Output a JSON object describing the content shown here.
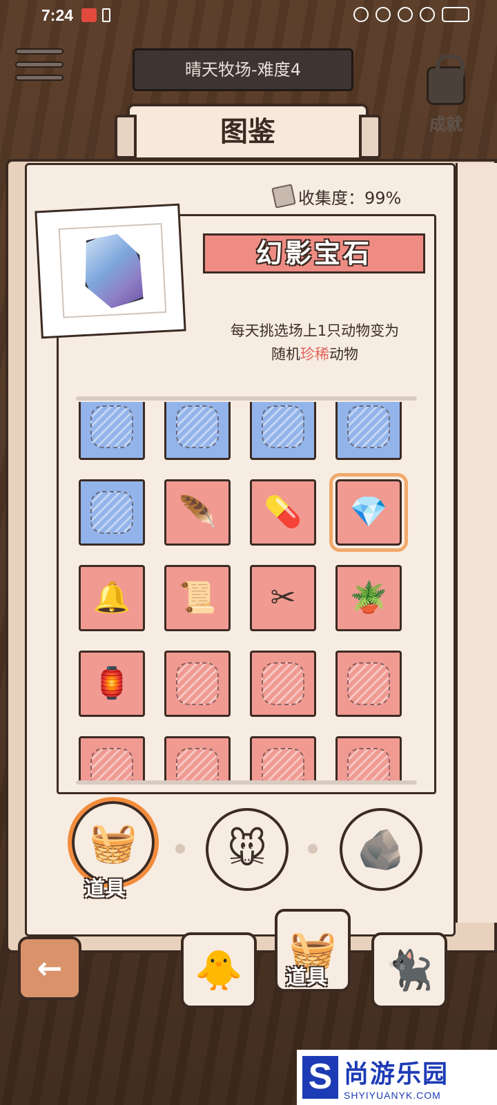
{
  "status_bar": {
    "time": "7:24"
  },
  "header": {
    "level_title": "晴天牧场-难度4",
    "achievements_label": "成就",
    "plaque_title": "图鉴"
  },
  "collection": {
    "label": "收集度：99%"
  },
  "detail": {
    "item_name": "幻影宝石",
    "desc_line1": "每天挑选场上1只动物变为",
    "desc_line2_prefix": "随机",
    "desc_line2_highlight": "珍稀",
    "desc_line2_suffix": "动物",
    "highlight_color": "#e0645c"
  },
  "grid_colors": {
    "pink": "#f09a92",
    "blue": "#93b4ea",
    "selected_outline": "#f2a96a"
  },
  "grid": [
    {
      "color": "blue",
      "icon": "locked-silhouette"
    },
    {
      "color": "blue",
      "icon": "locked-silhouette"
    },
    {
      "color": "blue",
      "icon": "locked-silhouette"
    },
    {
      "color": "blue",
      "icon": "locked-silhouette"
    },
    {
      "color": "blue",
      "icon": "locked-silhouette"
    },
    {
      "color": "pink",
      "icon": "feather-icon"
    },
    {
      "color": "pink",
      "icon": "pill-tray-icon"
    },
    {
      "color": "pink",
      "icon": "gem-icon",
      "selected": true
    },
    {
      "color": "pink",
      "icon": "hanging-bell-icon"
    },
    {
      "color": "pink",
      "icon": "scroll-icon"
    },
    {
      "color": "pink",
      "icon": "scissors-icon"
    },
    {
      "color": "pink",
      "icon": "potted-plant-icon"
    },
    {
      "color": "pink",
      "icon": "birdcage-icon"
    },
    {
      "color": "pink",
      "icon": "locked-silhouette"
    },
    {
      "color": "pink",
      "icon": "locked-silhouette"
    },
    {
      "color": "pink",
      "icon": "locked-silhouette"
    },
    {
      "color": "pink",
      "icon": "locked-silhouette"
    },
    {
      "color": "pink",
      "icon": "locked-silhouette"
    },
    {
      "color": "pink",
      "icon": "locked-silhouette"
    },
    {
      "color": "pink",
      "icon": "locked-silhouette"
    }
  ],
  "tabs": {
    "tools_label": "道具",
    "items": [
      {
        "name": "tools",
        "icon": "basket-icon",
        "active": true
      },
      {
        "name": "animals",
        "icon": "mouse-face-icon",
        "active": false
      },
      {
        "name": "stones",
        "icon": "rocks-icon",
        "active": false
      }
    ]
  },
  "bottom_bar": {
    "tools_label": "道具",
    "items": [
      {
        "name": "back",
        "icon": "back-arrow-icon"
      },
      {
        "name": "chick",
        "icon": "chick-icon"
      },
      {
        "name": "tools",
        "icon": "basket-icon"
      },
      {
        "name": "cat",
        "icon": "black-cat-icon"
      }
    ]
  },
  "watermark": {
    "logo_letter": "S",
    "cn": "尚游乐园",
    "en": "SHYIYUANYK.COM"
  }
}
